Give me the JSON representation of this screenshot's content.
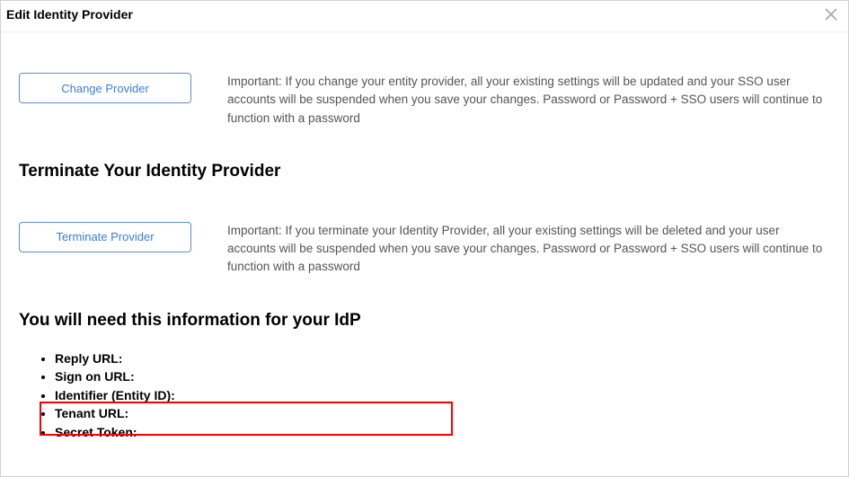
{
  "header": {
    "title": "Edit Identity Provider"
  },
  "change": {
    "button_label": "Change Provider",
    "info": "Important: If you change your entity provider, all your existing settings will be updated and your SSO user accounts will be suspended when you save your changes. Password or Password + SSO users will continue to function with a password"
  },
  "terminate": {
    "heading": "Terminate Your Identity Provider",
    "button_label": "Terminate Provider",
    "info": "Important: If you terminate your Identity Provider, all your existing settings will be deleted and your user accounts will be suspended when you save your changes. Password or Password + SSO users will continue to function with a password"
  },
  "idp_info": {
    "heading": "You will need this information for your IdP",
    "items": {
      "0": "Reply URL:",
      "1": "Sign on URL:",
      "2": "Identifier (Entity ID):",
      "3": "Tenant URL:",
      "4": "Secret Token:"
    }
  }
}
